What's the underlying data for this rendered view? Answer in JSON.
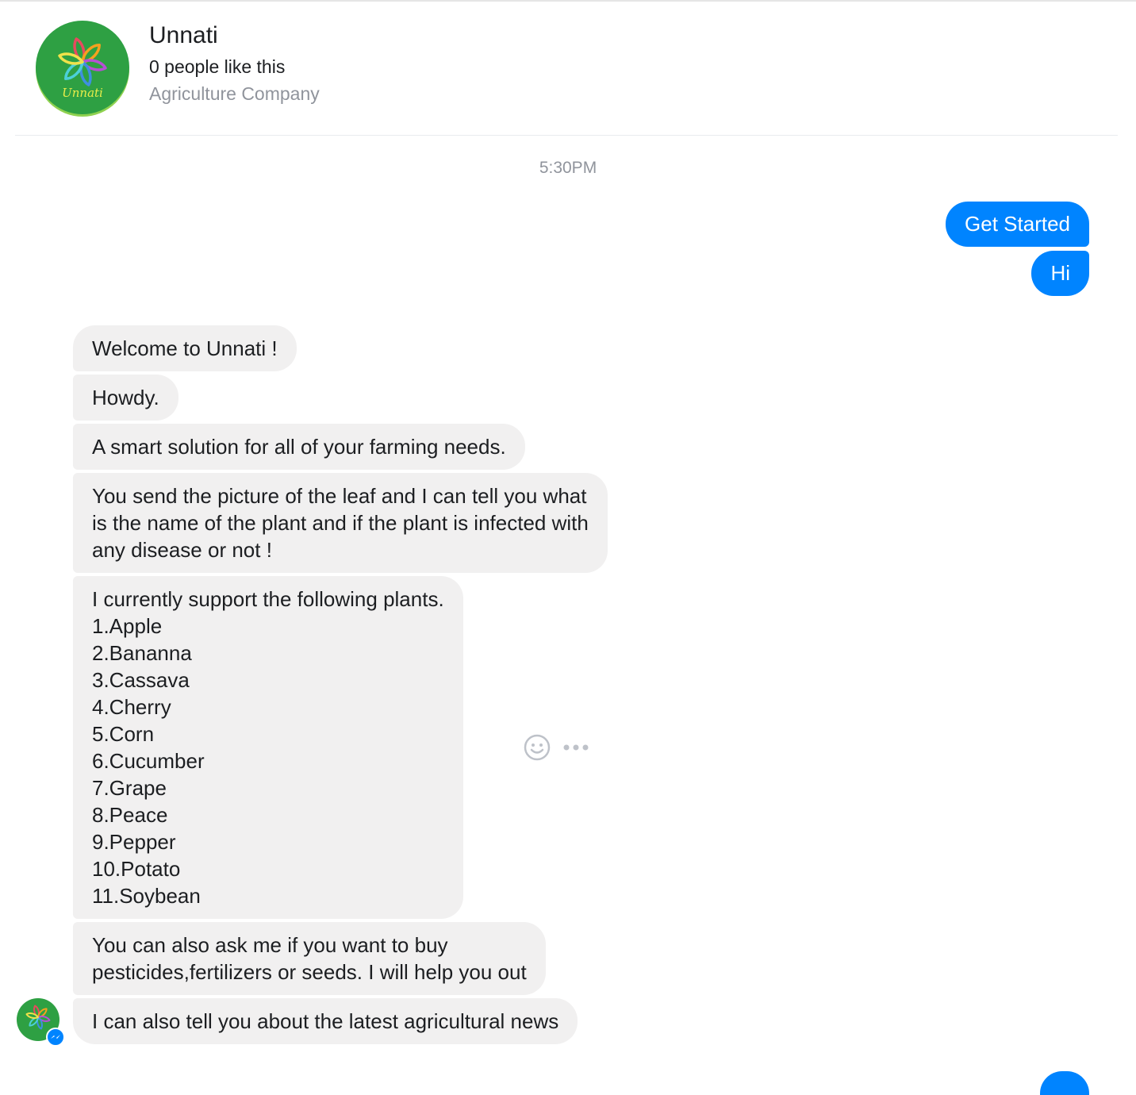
{
  "header": {
    "logo_text": "Unnati",
    "page_name": "Unnati",
    "likes": "0 people like this",
    "category": "Agriculture Company"
  },
  "conversation": {
    "timestamp": "5:30PM",
    "outgoing": [
      "Get Started",
      "Hi"
    ],
    "incoming": [
      "Welcome to Unnati !",
      "Howdy.",
      "A smart solution for all of your farming needs.",
      "You send the picture of the leaf and I can tell you what\nis the name of the plant and if the plant is infected with\nany disease or not !",
      "I currently support the following plants.\n1.Apple\n2.Bananna\n3.Cassava\n4.Cherry\n5.Corn\n6.Cucumber\n7.Grape\n8.Peace\n9.Pepper\n10.Potato\n11.Soybean",
      "You can also ask me if you want to buy\npesticides,fertilizers or seeds. I will help you out",
      "I can also tell you about the latest agricultural news"
    ]
  },
  "icons": {
    "reaction": "smiley-icon",
    "more": "more-dots-icon",
    "badge": "messenger-badge-icon"
  },
  "colors": {
    "accent": "#0084ff",
    "incoming_bubble": "#f1f0f0",
    "logo_green": "#2ea043",
    "muted_text": "#90949c"
  }
}
